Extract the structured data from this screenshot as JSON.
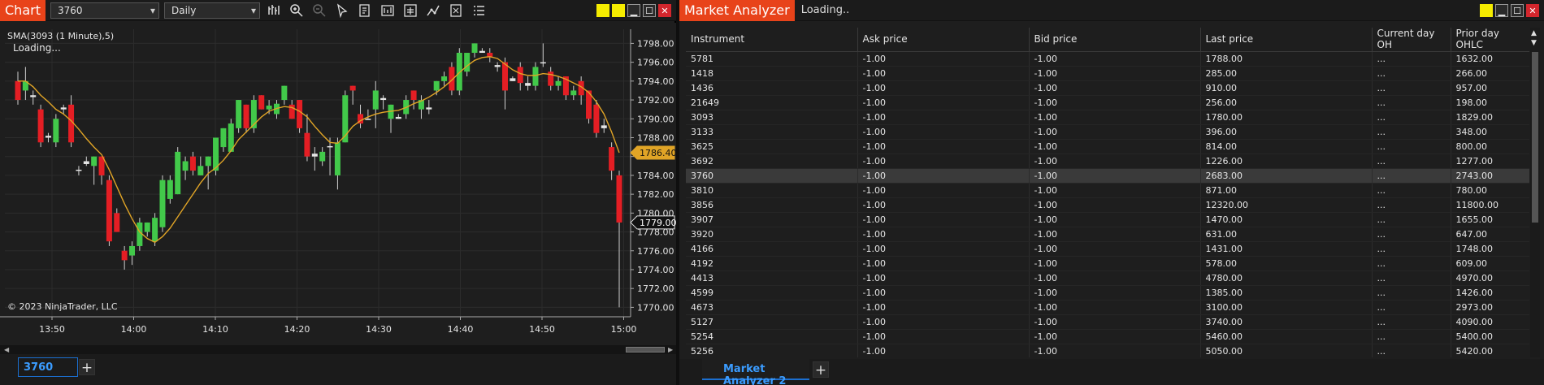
{
  "chart": {
    "title": "Chart",
    "instrument": "3760",
    "period": "Daily",
    "indicator_label": "SMA(3093 (1 Minute),5)",
    "loading_text": "Loading...",
    "copyright": "© 2023 NinjaTrader, LLC",
    "tab_label": "3760",
    "price_marker_sma": "1786.40",
    "price_marker_last": "1779.00",
    "colors": {
      "up": "#42c94a",
      "down": "#e41e24",
      "sma": "#e0a426",
      "marker": "#e0a426"
    },
    "chart_data": {
      "type": "candlestick",
      "x_tick_labels": [
        "13:50",
        "14:00",
        "14:10",
        "14:20",
        "14:30",
        "14:40",
        "14:50",
        "15:00"
      ],
      "y_tick_labels": [
        "1798.00",
        "1796.00",
        "1794.00",
        "1792.00",
        "1790.00",
        "1788.00",
        "1786.00",
        "1784.00",
        "1782.00",
        "1780.00",
        "1778.00",
        "1776.00",
        "1774.00",
        "1772.00",
        "1770.00"
      ],
      "ylim": [
        1769,
        1799.5
      ],
      "grid": true,
      "candles": [
        [
          1794,
          1792,
          1795,
          1791.5
        ],
        [
          1793,
          1794,
          1795.5,
          1792
        ],
        [
          1792.5,
          1792.3,
          1793,
          1791.5
        ],
        [
          1791,
          1787.5,
          1791.5,
          1787
        ],
        [
          1788,
          1788.2,
          1788.5,
          1787.5
        ],
        [
          1787.5,
          1790,
          1790.5,
          1787
        ],
        [
          1791,
          1791.2,
          1791.5,
          1790.5
        ],
        [
          1791.5,
          1787.5,
          1792.5,
          1787
        ],
        [
          1784.5,
          1784.6,
          1785,
          1784
        ],
        [
          1785.5,
          1785.2,
          1786,
          1785
        ],
        [
          1785,
          1786,
          1786,
          1783
        ],
        [
          1786,
          1784,
          1786,
          1783
        ],
        [
          1783.5,
          1777,
          1784,
          1776.5
        ],
        [
          1780,
          1778,
          1780.5,
          1778
        ],
        [
          1776,
          1775,
          1776.5,
          1774
        ],
        [
          1775.5,
          1776.5,
          1777,
          1774.5
        ],
        [
          1776.5,
          1779,
          1779.5,
          1776
        ],
        [
          1778,
          1779,
          1779,
          1777.5
        ],
        [
          1777,
          1779.5,
          1780,
          1776.5
        ],
        [
          1778.5,
          1783.5,
          1784,
          1778
        ],
        [
          1781.5,
          1783.5,
          1784,
          1781
        ],
        [
          1782,
          1786.5,
          1787,
          1782
        ],
        [
          1784.5,
          1785.5,
          1786,
          1783.5
        ],
        [
          1786,
          1784.5,
          1786.5,
          1784
        ],
        [
          1784,
          1785,
          1786,
          1784
        ],
        [
          1785,
          1786,
          1786,
          1782.5
        ],
        [
          1784.5,
          1788,
          1788,
          1784
        ],
        [
          1787,
          1789,
          1789,
          1786.5
        ],
        [
          1786.5,
          1789.5,
          1790,
          1786.5
        ],
        [
          1789,
          1792,
          1792,
          1788.5
        ],
        [
          1791.5,
          1789,
          1791.5,
          1788.5
        ],
        [
          1789,
          1792,
          1792.5,
          1788.5
        ],
        [
          1792.5,
          1791,
          1792.5,
          1791
        ],
        [
          1791,
          1791.4,
          1792,
          1790.5
        ],
        [
          1790.5,
          1791.6,
          1792,
          1790
        ],
        [
          1792,
          1793.5,
          1793.5,
          1791.5
        ],
        [
          1791.5,
          1790,
          1792,
          1790
        ],
        [
          1792,
          1789,
          1792,
          1788.5
        ],
        [
          1788.5,
          1786,
          1790.5,
          1785.5
        ],
        [
          1786,
          1786.3,
          1787,
          1784.5
        ],
        [
          1785.5,
          1786.5,
          1787,
          1785
        ],
        [
          1787,
          1787.1,
          1788,
          1784
        ],
        [
          1784,
          1787.5,
          1788,
          1782.5
        ],
        [
          1787.5,
          1792.5,
          1793,
          1787.5
        ],
        [
          1793.5,
          1793,
          1793.5,
          1791.5
        ],
        [
          1790.5,
          1789.5,
          1791.5,
          1789
        ],
        [
          1790,
          1790,
          1791,
          1790
        ],
        [
          1791,
          1793,
          1794,
          1789
        ],
        [
          1792,
          1792.2,
          1792.5,
          1791
        ],
        [
          1790,
          1791.5,
          1791.5,
          1788.5
        ],
        [
          1790,
          1790.2,
          1790.5,
          1790
        ],
        [
          1790.5,
          1792,
          1792.5,
          1790
        ],
        [
          1793,
          1792,
          1793,
          1791
        ],
        [
          1791,
          1792,
          1792.5,
          1790
        ],
        [
          1791,
          1791.2,
          1792,
          1790.5
        ],
        [
          1793,
          1794,
          1794,
          1792.5
        ],
        [
          1794,
          1794.5,
          1795,
          1793.5
        ],
        [
          1795.5,
          1793,
          1796,
          1792.5
        ],
        [
          1793,
          1797,
          1797.5,
          1792.5
        ],
        [
          1795,
          1797,
          1797,
          1794.5
        ],
        [
          1797,
          1798,
          1798,
          1796.5
        ],
        [
          1797,
          1797.2,
          1797.5,
          1797
        ],
        [
          1797,
          1796.5,
          1797.5,
          1796
        ],
        [
          1795.5,
          1795.7,
          1796,
          1795
        ],
        [
          1796,
          1793,
          1796.5,
          1791
        ],
        [
          1794,
          1794.3,
          1794.5,
          1794
        ],
        [
          1795.5,
          1793.8,
          1796,
          1793
        ],
        [
          1793.5,
          1793.8,
          1794.5,
          1793
        ],
        [
          1793.5,
          1795.5,
          1796,
          1793
        ],
        [
          1796,
          1796,
          1798,
          1795.5
        ],
        [
          1795,
          1793.5,
          1795.5,
          1793
        ],
        [
          1793.5,
          1794,
          1794.5,
          1793
        ],
        [
          1794.5,
          1792.5,
          1794.5,
          1792
        ],
        [
          1792.5,
          1793,
          1793.5,
          1792
        ],
        [
          1794,
          1792.5,
          1794.5,
          1791.5
        ],
        [
          1793,
          1790,
          1793,
          1789.5
        ],
        [
          1791.5,
          1788.5,
          1792,
          1788
        ],
        [
          1789,
          1789.3,
          1790,
          1788.5
        ],
        [
          1787,
          1784.5,
          1787.5,
          1783.5
        ],
        [
          1784,
          1779,
          1784.5,
          1770
        ]
      ],
      "sma": [
        1794,
        1794,
        1793.4,
        1792.5,
        1791.8,
        1791,
        1790.5,
        1789.8,
        1788.9,
        1787.9,
        1787,
        1786.2,
        1784.6,
        1782.8,
        1781,
        1779.4,
        1778,
        1777.3,
        1776.9,
        1777.5,
        1778.4,
        1779.6,
        1780.8,
        1782,
        1783.2,
        1784.2,
        1784.8,
        1785.6,
        1786.6,
        1787.8,
        1788.6,
        1789.4,
        1790.2,
        1790.8,
        1791.1,
        1791.3,
        1791.2,
        1790.8,
        1790.2,
        1789.2,
        1788.3,
        1787.5,
        1787.4,
        1788.2,
        1789.2,
        1789.8,
        1790.2,
        1790.5,
        1790.7,
        1790.8,
        1790.9,
        1791.2,
        1791.6,
        1791.9,
        1792.3,
        1792.8,
        1793.4,
        1794.1,
        1794.9,
        1795.6,
        1796.2,
        1796.5,
        1796.6,
        1796.4,
        1795.8,
        1795.2,
        1794.8,
        1794.6,
        1794.6,
        1794.8,
        1794.7,
        1794.5,
        1794.2,
        1793.8,
        1793.4,
        1792.8,
        1791.8,
        1790.5,
        1788.6,
        1786.4
      ]
    }
  },
  "analyzer": {
    "title": "Market Analyzer",
    "status": "Loading..",
    "tab_label": "Market Analyzer 2",
    "columns": [
      "Instrument",
      "Ask price",
      "Bid price",
      "Last price",
      "Current day OH",
      "Prior day OHLC"
    ],
    "rows": [
      [
        "5781",
        "-1.00",
        "-1.00",
        "1788.00",
        "...",
        "1632.00"
      ],
      [
        "1418",
        "-1.00",
        "-1.00",
        "285.00",
        "...",
        "266.00"
      ],
      [
        "1436",
        "-1.00",
        "-1.00",
        "910.00",
        "...",
        "957.00"
      ],
      [
        "21649",
        "-1.00",
        "-1.00",
        "256.00",
        "...",
        "198.00"
      ],
      [
        "3093",
        "-1.00",
        "-1.00",
        "1780.00",
        "...",
        "1829.00"
      ],
      [
        "3133",
        "-1.00",
        "-1.00",
        "396.00",
        "...",
        "348.00"
      ],
      [
        "3625",
        "-1.00",
        "-1.00",
        "814.00",
        "...",
        "800.00"
      ],
      [
        "3692",
        "-1.00",
        "-1.00",
        "1226.00",
        "...",
        "1277.00"
      ],
      [
        "3760",
        "-1.00",
        "-1.00",
        "2683.00",
        "...",
        "2743.00"
      ],
      [
        "3810",
        "-1.00",
        "-1.00",
        "871.00",
        "...",
        "780.00"
      ],
      [
        "3856",
        "-1.00",
        "-1.00",
        "12320.00",
        "...",
        "11800.00"
      ],
      [
        "3907",
        "-1.00",
        "-1.00",
        "1470.00",
        "...",
        "1655.00"
      ],
      [
        "3920",
        "-1.00",
        "-1.00",
        "631.00",
        "...",
        "647.00"
      ],
      [
        "4166",
        "-1.00",
        "-1.00",
        "1431.00",
        "...",
        "1748.00"
      ],
      [
        "4192",
        "-1.00",
        "-1.00",
        "578.00",
        "...",
        "609.00"
      ],
      [
        "4413",
        "-1.00",
        "-1.00",
        "4780.00",
        "...",
        "4970.00"
      ],
      [
        "4599",
        "-1.00",
        "-1.00",
        "1385.00",
        "...",
        "1426.00"
      ],
      [
        "4673",
        "-1.00",
        "-1.00",
        "3100.00",
        "...",
        "2973.00"
      ],
      [
        "5127",
        "-1.00",
        "-1.00",
        "3740.00",
        "...",
        "4090.00"
      ],
      [
        "5254",
        "-1.00",
        "-1.00",
        "5460.00",
        "...",
        "5400.00"
      ],
      [
        "5256",
        "-1.00",
        "-1.00",
        "5050.00",
        "...",
        "5420.00"
      ]
    ],
    "selected_row": 8
  }
}
